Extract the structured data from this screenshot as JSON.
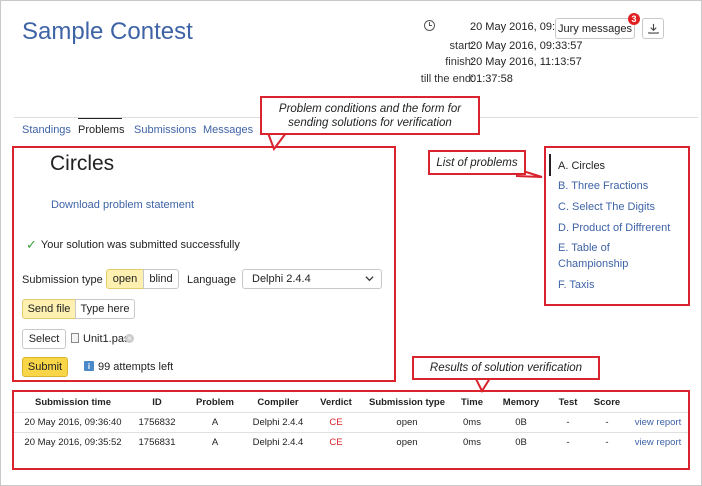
{
  "contest": {
    "title": "Sample Contest"
  },
  "timer": {
    "current_label": "",
    "current": "20 May 2016, 09:35:52",
    "start_label": "start:",
    "start": "20 May 2016, 09:33:57",
    "finish_label": "finish:",
    "finish": "20 May 2016, 11:13:57",
    "till_end_label": "till the end:",
    "till_end": "01:37:58"
  },
  "header_buttons": {
    "jury_messages": "Jury messages",
    "jury_badge": "3"
  },
  "tabs": [
    {
      "label": "Standings",
      "active": false
    },
    {
      "label": "Problems",
      "active": true
    },
    {
      "label": "Submissions",
      "active": false
    },
    {
      "label": "Messages",
      "active": false
    }
  ],
  "problem": {
    "title": "Circles",
    "download_link": "Download problem statement",
    "success_message": "Your solution was submitted successfully"
  },
  "submission_form": {
    "type_label": "Submission type",
    "type_options": [
      "open",
      "blind"
    ],
    "type_selected": "open",
    "language_label": "Language",
    "language_selected": "Delphi 2.4.4",
    "mode_options": [
      "Send file",
      "Type here"
    ],
    "mode_selected": "Send file",
    "select_label": "Select",
    "file_name": "Unit1.pas",
    "submit_label": "Submit",
    "attempts_left": "99 attempts left"
  },
  "problem_list": [
    {
      "label": "A. Circles",
      "active": true
    },
    {
      "label": "B. Three Fractions",
      "active": false
    },
    {
      "label": "C. Select The Digits",
      "active": false
    },
    {
      "label": "D. Product of Diffrerent",
      "active": false
    },
    {
      "label": "E. Table of Championship",
      "active": false
    },
    {
      "label": "F. Taxis",
      "active": false
    }
  ],
  "results": {
    "columns": [
      "Submission time",
      "ID",
      "Problem",
      "Compiler",
      "Verdict",
      "Submission type",
      "Time",
      "Memory",
      "Test",
      "Score",
      ""
    ],
    "rows": [
      [
        "20 May 2016, 09:36:40",
        "1756832",
        "A",
        "Delphi 2.4.4",
        "CE",
        "open",
        "0ms",
        "0B",
        "-",
        "-",
        "view report"
      ],
      [
        "20 May 2016, 09:35:52",
        "1756831",
        "A",
        "Delphi 2.4.4",
        "CE",
        "open",
        "0ms",
        "0B",
        "-",
        "-",
        "view report"
      ]
    ]
  },
  "annotations": {
    "problem_callout": "Problem conditions and the form for sending solutions for verification",
    "problem_list_callout": "List of problems",
    "results_callout": "Results of solution verification"
  },
  "colors": {
    "accent": "#3e63a6",
    "annotation": "#d9232d",
    "submit": "#f9d648",
    "verdict_ce": "#d9232d"
  },
  "icons": {
    "timer": "clock-icon",
    "download": "download-icon",
    "file": "file-icon",
    "remove": "remove-icon",
    "info": "info-icon",
    "success": "check-icon"
  }
}
